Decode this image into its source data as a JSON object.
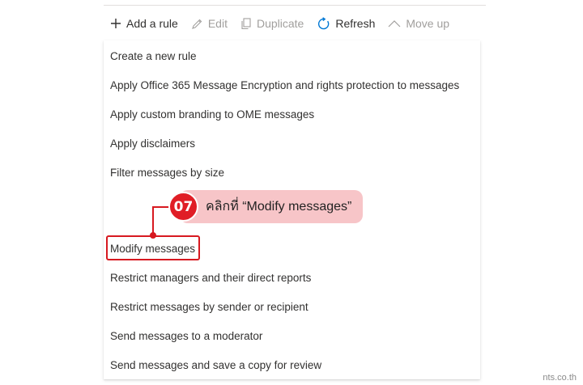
{
  "toolbar": {
    "add_rule": "Add a rule",
    "edit": "Edit",
    "duplicate": "Duplicate",
    "refresh": "Refresh",
    "move_up": "Move up"
  },
  "menu": {
    "items": [
      "Create a new rule",
      "Apply Office 365 Message Encryption and rights protection to messages",
      "Apply custom branding to OME messages",
      "Apply disclaimers",
      "Filter messages by size",
      "Modify messages",
      "Restrict managers and their direct reports",
      "Restrict messages by sender or recipient",
      "Send messages to a moderator",
      "Send messages and save a copy for review"
    ]
  },
  "annotation": {
    "step_number": "07",
    "instruction": "คลิกที่ “Modify messages”"
  },
  "watermark": "nts.co.th",
  "icons": {
    "add": "plus-icon",
    "edit": "pencil-icon",
    "duplicate": "copy-icon",
    "refresh": "refresh-icon",
    "move_up": "chevron-up-icon"
  },
  "colors": {
    "accent_blue": "#0078d4",
    "highlight_red": "#d71920",
    "callout_pink": "#f7c5c8",
    "disabled_text": "#a19f9d"
  }
}
